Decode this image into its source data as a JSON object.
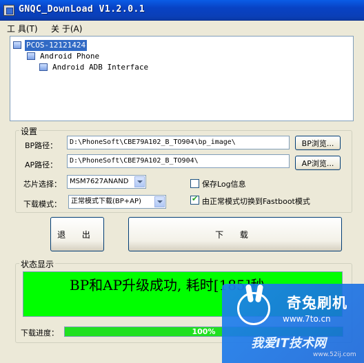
{
  "window": {
    "title": "GNQC_DownLoad V1.2.0.1"
  },
  "menu": [
    {
      "label": "工 具(T)"
    },
    {
      "label": "关 于(A)"
    }
  ],
  "device_tree": [
    {
      "label": "PCOS-12121424",
      "selected": true
    },
    {
      "label": "Android Phone"
    },
    {
      "label": "Android ADB Interface"
    }
  ],
  "settings": {
    "group_title": "设置",
    "bp_path_label": "BP路径：",
    "bp_path_value": "D:\\PhoneSoft\\CBE79A102_B_TO904\\bp_image\\",
    "bp_browse": "BP浏览...",
    "ap_path_label": "AP路径：",
    "ap_path_value": "D:\\PhoneSoft\\CBE79A102_B_TO904\\",
    "ap_browse": "AP浏览...",
    "chip_label": "芯片选择：",
    "chip_value": "MSM7627ANAND",
    "mode_label": "下载模式：",
    "mode_value": "正常模式下载(BP+AP)",
    "save_log_label": "保存Log信息",
    "save_log_checked": false,
    "fastboot_label": "由正常模式切换到Fastboot模式",
    "fastboot_checked": true
  },
  "actions": {
    "exit_label": "退 出",
    "download_label": "下 载"
  },
  "status": {
    "group_title": "状态显示",
    "message": "BP和AP升级成功, 耗时[185]秒",
    "progress_label": "下载进度：",
    "progress_value": 100,
    "progress_text": "100%"
  },
  "watermark": {
    "title": "奇兔刷机",
    "url": "www.7to.cn",
    "sub": "我爱IT技术网",
    "sub2": "www.52ij.com"
  },
  "colors": {
    "status_bg": "#00ff00",
    "progress_fill": "#20e020",
    "titlebar": "#0a3fb8"
  }
}
